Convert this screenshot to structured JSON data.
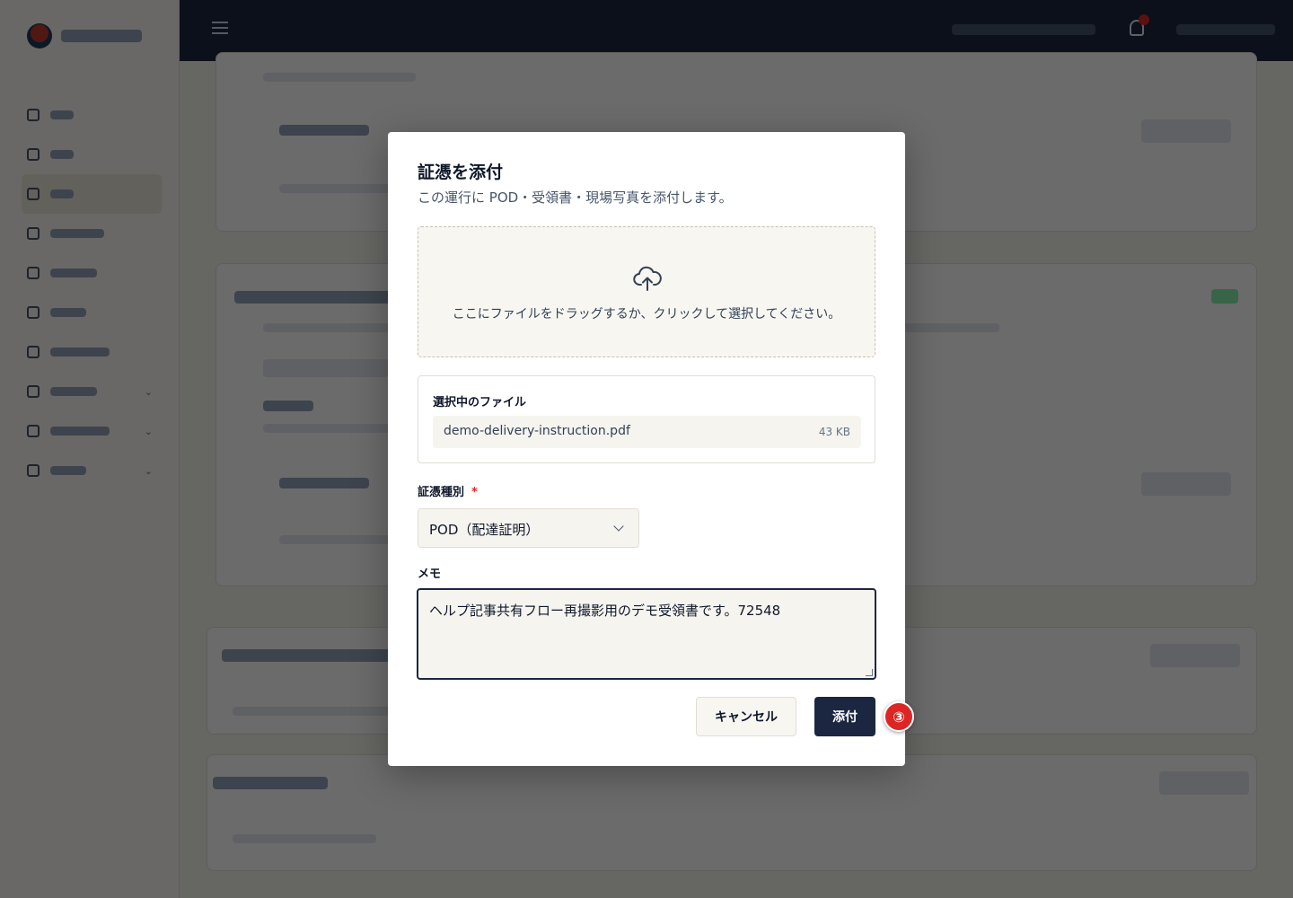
{
  "dialog": {
    "title": "証憑を添付",
    "description": "この運行に POD・受領書・現場写真を添付します。",
    "dropzone_text": "ここにファイルをドラッグするか、クリックして選択してください。",
    "selected_files_heading": "選択中のファイル",
    "file": {
      "name": "demo-delivery-instruction.pdf",
      "size": "43 KB"
    },
    "type_label": "証憑種別",
    "required_mark": "*",
    "type_value": "POD（配達証明）",
    "memo_label": "メモ",
    "memo_value": "ヘルプ記事共有フロー再撮影用のデモ受領書です。72548",
    "cancel_label": "キャンセル",
    "attach_label": "添付"
  },
  "step_badge": "③",
  "colors": {
    "accent": "#1b2740",
    "required": "#dc2626",
    "badge": "#dc2626",
    "field_bg": "#f5f4ef"
  },
  "icons": [
    "cloud-upload-icon",
    "chevron-down-icon",
    "menu-icon",
    "bell-icon"
  ]
}
